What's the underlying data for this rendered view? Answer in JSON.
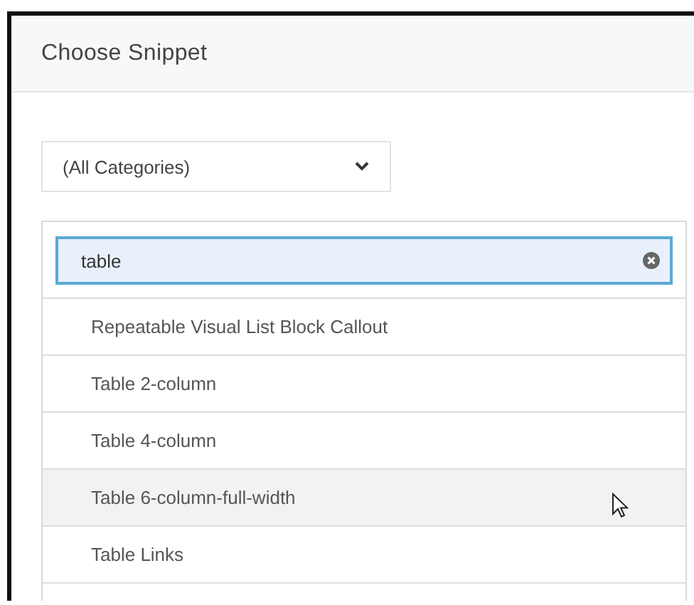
{
  "dialog": {
    "title": "Choose Snippet"
  },
  "category_select": {
    "value": "(All Categories)"
  },
  "search": {
    "value": "table"
  },
  "results": [
    {
      "label": "Repeatable Visual List Block Callout",
      "highlighted": false
    },
    {
      "label": "Table 2-column",
      "highlighted": false
    },
    {
      "label": "Table 4-column",
      "highlighted": false
    },
    {
      "label": "Table 6-column-full-width",
      "highlighted": true
    },
    {
      "label": "Table Links",
      "highlighted": false
    }
  ]
}
